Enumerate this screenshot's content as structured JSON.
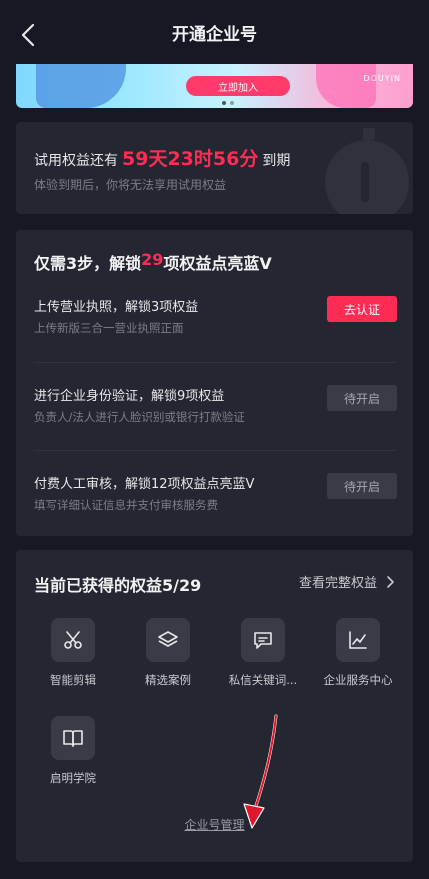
{
  "header": {
    "title": "开通企业号"
  },
  "banner": {
    "button_label": "立即加入",
    "brand": "DOUYIN"
  },
  "trial": {
    "prefix": "试用权益还有",
    "time": "59天23时56分",
    "suffix": "到期",
    "subtitle": "体验到期后，你将无法享用试用权益"
  },
  "steps": {
    "title_pre": "仅需3步，解锁",
    "title_num": "29",
    "title_post": "项权益点亮蓝V",
    "items": [
      {
        "name": "上传营业执照，解锁3项权益",
        "desc": "上传新版三合一营业执照正面",
        "button": "去认证"
      },
      {
        "name": "进行企业身份验证，解锁9项权益",
        "desc": "负责人/法人进行人脸识别或银行打款验证",
        "button": "待开启"
      },
      {
        "name": "付费人工审核，解锁12项权益点亮蓝V",
        "desc": "填写详细认证信息并支付审核服务费",
        "button": "待开启"
      }
    ]
  },
  "rights": {
    "title": "当前已获得的权益5/29",
    "more": "查看完整权益",
    "items": [
      {
        "label": "智能剪辑",
        "icon": "scissors-icon"
      },
      {
        "label": "精选案例",
        "icon": "layers-icon"
      },
      {
        "label": "私信关键词...",
        "icon": "message-icon"
      },
      {
        "label": "企业服务中心",
        "icon": "chart-icon"
      },
      {
        "label": "启明学院",
        "icon": "book-icon"
      }
    ],
    "manage": "企业号管理"
  },
  "colors": {
    "accent": "#fe2c55",
    "background": "#161823",
    "card": "#242631"
  }
}
